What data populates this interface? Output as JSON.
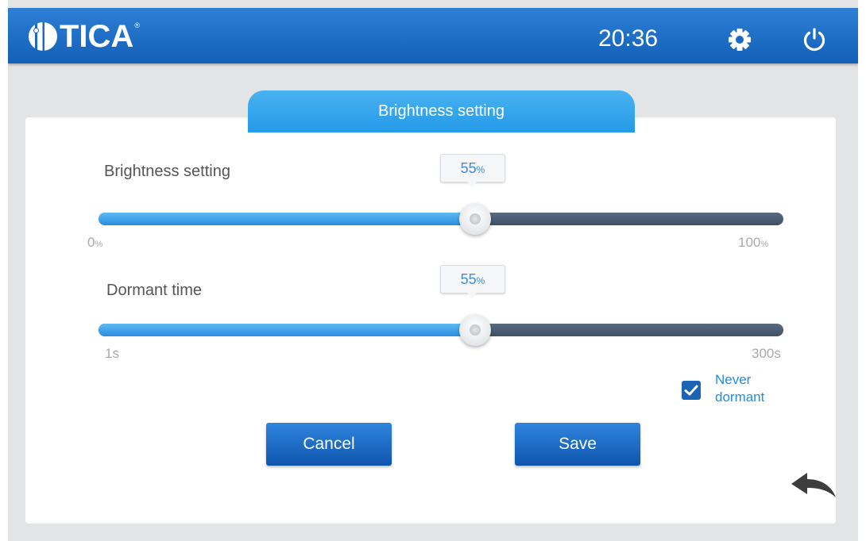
{
  "header": {
    "logo_text": "TICA",
    "logo_registered": "®",
    "time": "20:36",
    "settings_icon": "gear-icon",
    "power_icon": "power-icon"
  },
  "tab": {
    "title": "Brightness setting"
  },
  "brightness": {
    "label": "Brightness setting",
    "value": "55",
    "value_unit": "%",
    "level_fraction": 0.55,
    "min_value": "0",
    "min_unit": "%",
    "max_value": "100",
    "max_unit": "%"
  },
  "dormant": {
    "label": "Dormant time",
    "value": "55",
    "value_unit": "%",
    "level_fraction": 0.55,
    "min_label": "1s",
    "max_label": "300s"
  },
  "never_dormant": {
    "label": "Never dormant",
    "checked": true
  },
  "buttons": {
    "cancel": "Cancel",
    "save": "Save"
  },
  "back_icon": "back-arrow-icon",
  "colors": {
    "header": "#1a6ac6",
    "tab": "#2e9fea",
    "slider_fill": "#3d9be6",
    "slider_track": "#4a5a70",
    "button": "#1b63b5",
    "accent_text": "#1e8ce6"
  }
}
